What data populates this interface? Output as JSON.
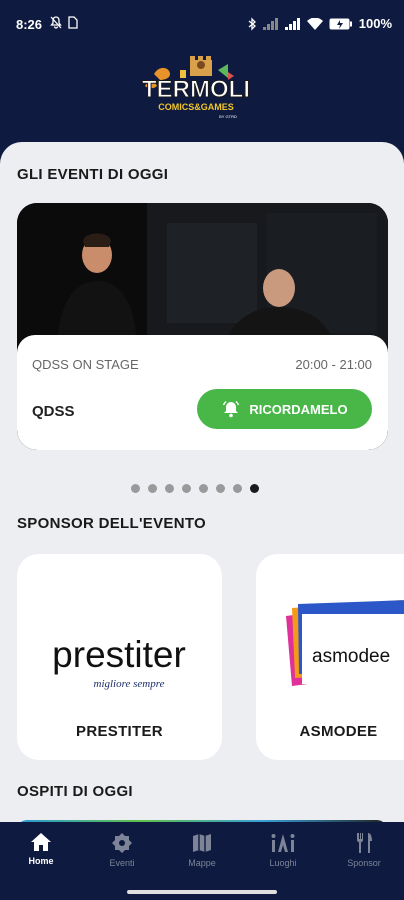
{
  "status_bar": {
    "time": "8:26",
    "battery": "100%"
  },
  "header": {
    "logo_text": "TERMOLI",
    "logo_subtitle": "COMICS & GAMES"
  },
  "events_section": {
    "title": "GLI EVENTI DI OGGI",
    "event": {
      "stage": "QDSS ON STAGE",
      "time": "20:00 - 21:00",
      "name": "QDSS",
      "remind_label": "RICORDAMELO"
    },
    "carousel": {
      "total": 8,
      "active_index": 7
    }
  },
  "sponsors_section": {
    "title": "SPONSOR DELL'EVENTO",
    "items": [
      {
        "label": "PRESTITER",
        "logo_text": "prestiter",
        "tagline": "migliore sempre"
      },
      {
        "label": "ASMODEE",
        "logo_text": "asmodee"
      }
    ]
  },
  "guests_section": {
    "title": "OSPITI DI OGGI"
  },
  "nav": {
    "items": [
      {
        "label": "Home",
        "icon": "home-icon",
        "active": true
      },
      {
        "label": "Eventi",
        "icon": "badge-icon",
        "active": false
      },
      {
        "label": "Mappe",
        "icon": "map-icon",
        "active": false
      },
      {
        "label": "Luoghi",
        "icon": "places-icon",
        "active": false
      },
      {
        "label": "Sponsor",
        "icon": "cutlery-icon",
        "active": false
      }
    ]
  },
  "colors": {
    "background": "#0e1a3f",
    "accent_green": "#48b748",
    "content_bg": "#eceef1"
  }
}
